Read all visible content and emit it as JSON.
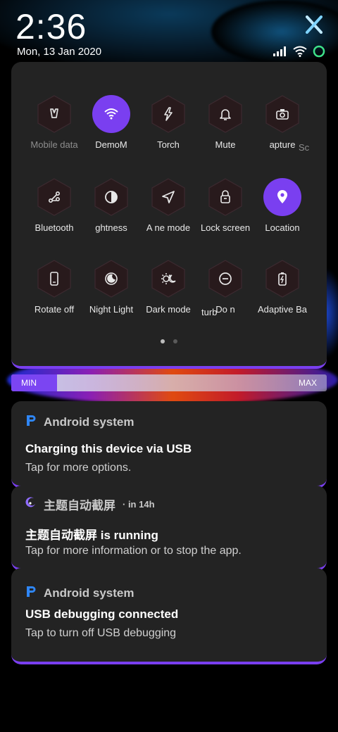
{
  "status_bar": {
    "time": "2:36",
    "date": "Mon, 13 Jan 2020"
  },
  "quick_settings": {
    "tiles": [
      {
        "label": "Mobile data",
        "icon": "mobile-data-icon",
        "active": false,
        "dim": true
      },
      {
        "label": "DemoM",
        "icon": "wifi-icon",
        "active": true,
        "dim": false
      },
      {
        "label": "Torch",
        "icon": "torch-icon",
        "active": false,
        "dim": false
      },
      {
        "label": "Mute",
        "icon": "bell-icon",
        "active": false,
        "dim": false
      },
      {
        "label": "apture",
        "icon": "camera-icon",
        "active": false,
        "dim": false
      },
      {
        "label": "Bluetooth",
        "icon": "bluetooth-icon",
        "active": false,
        "dim": false
      },
      {
        "label": "ghtness",
        "icon": "brightness-icon",
        "active": false,
        "dim": false
      },
      {
        "label": "A ne mode",
        "icon": "airplane-icon",
        "active": false,
        "dim": false
      },
      {
        "label": "Lock screen",
        "icon": "lock-screen-icon",
        "active": false,
        "dim": false
      },
      {
        "label": "Location",
        "icon": "location-icon",
        "active": true,
        "dim": false
      },
      {
        "label": "Rotate off",
        "icon": "rotate-icon",
        "active": false,
        "dim": false
      },
      {
        "label": "Night Light",
        "icon": "night-light-icon",
        "active": false,
        "dim": false
      },
      {
        "label": "Dark mode",
        "icon": "dark-mode-icon",
        "active": false,
        "dim": false
      },
      {
        "label": "Do n",
        "icon": "do-not-disturb-icon",
        "active": false,
        "dim": false
      },
      {
        "label": "Adaptive Ba",
        "icon": "battery-icon",
        "active": false,
        "dim": false
      }
    ],
    "overflow_labels": [
      "Sc",
      "turb"
    ],
    "page": 1,
    "page_count": 2
  },
  "brightness": {
    "min_label": "MIN",
    "max_label": "MAX",
    "level": 0.145
  },
  "notifications": [
    {
      "app": "Android system",
      "time": "",
      "title": "Charging this device via USB",
      "text": "Tap for more options."
    },
    {
      "app": "主题自动截屏",
      "time": "· in 14h",
      "title": "主题自动截屏 is running",
      "text": "Tap for more information or to stop the app."
    },
    {
      "app": "Android system",
      "time": "",
      "title": "USB debugging connected",
      "text": "Tap to turn off USB debugging"
    }
  ],
  "colors": {
    "accent": "#7a3ff0",
    "panel": "#232323",
    "app_icon_blue": "#2f86f6"
  }
}
